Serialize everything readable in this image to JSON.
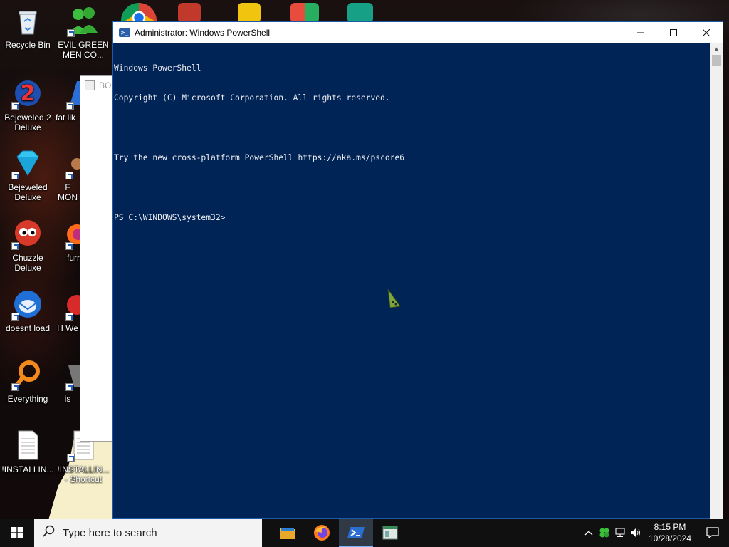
{
  "desktop": {
    "icons_col1": [
      {
        "label": "Recycle Bin"
      },
      {
        "label": "Bejeweled 2 Deluxe"
      },
      {
        "label": "Bejeweled Deluxe"
      },
      {
        "label": "Chuzzle Deluxe"
      },
      {
        "label": "doesnt load"
      },
      {
        "label": "Everything"
      },
      {
        "label": "!INSTALLIN..."
      }
    ],
    "icons_col2": [
      {
        "label": "EVIL GREEN MEN CO..."
      },
      {
        "label": "fat lik"
      },
      {
        "label": "F MON"
      },
      {
        "label": "furr"
      },
      {
        "label": "H We"
      },
      {
        "label": "is"
      },
      {
        "label": "!INSTALLIN... - Shortcut"
      }
    ]
  },
  "bg_window": {
    "title": "BO"
  },
  "powershell": {
    "title": "Administrator: Windows PowerShell",
    "lines": [
      "Windows PowerShell",
      "Copyright (C) Microsoft Corporation. All rights reserved.",
      "",
      "Try the new cross-platform PowerShell https://aka.ms/pscore6",
      "",
      "PS C:\\WINDOWS\\system32>"
    ]
  },
  "taskbar": {
    "search_placeholder": "Type here to search",
    "time": "8:15 PM",
    "date": "10/28/2024"
  },
  "colors": {
    "console_bg": "#012456",
    "console_text": "#eeedf0",
    "taskbar": "#101010"
  }
}
